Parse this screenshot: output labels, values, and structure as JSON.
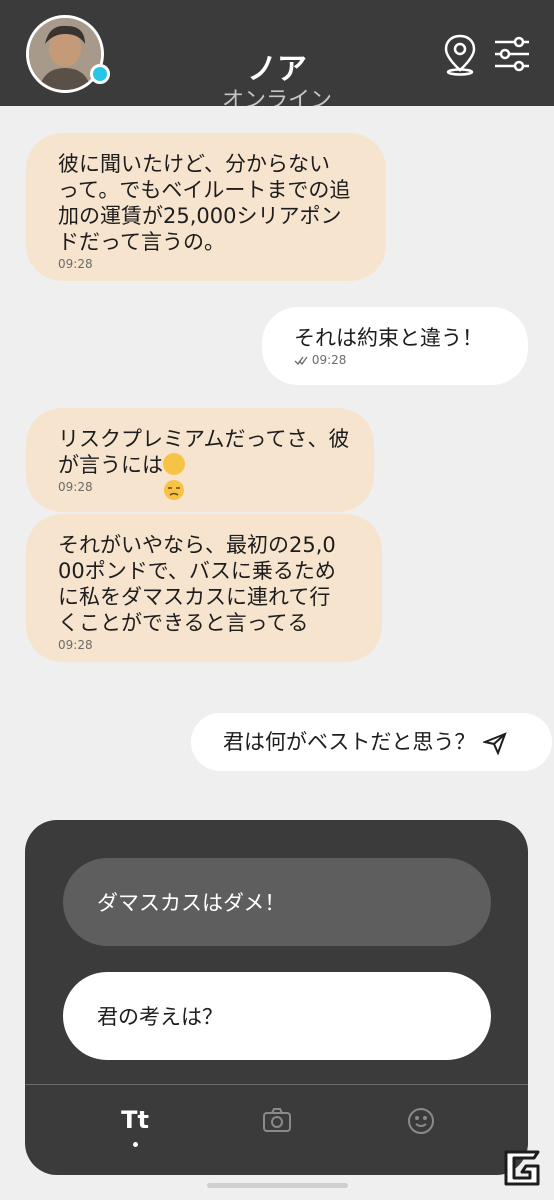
{
  "header": {
    "name": "ノア",
    "status": "オンライン",
    "avatar": "avatar",
    "icons": [
      "location-pin-icon",
      "filter-sliders-icon"
    ],
    "status_color": "#27c6e6"
  },
  "messages": [
    {
      "side": "incoming",
      "text": "彼に聞いたけど、分からない\nって。でもベイルートまでの追\n加の運賃が25,000シリアポン\nドだって言うの。",
      "time": "09:28"
    },
    {
      "side": "outgoing",
      "text": "それは約束と違う！",
      "time": "09:28",
      "read_icon": "double-check-icon"
    },
    {
      "side": "incoming",
      "text": "リスクプレミアムだってさ、彼\nが言うには",
      "time": "09:28",
      "emoji": "unamused-face-icon"
    },
    {
      "side": "incoming",
      "text": "それがいやなら、最初の25,0\n00ポンドで、バスに乗るため\nに私をダマスカスに連れて行\nくことができると言ってる",
      "time": "09:28"
    },
    {
      "side": "outgoing",
      "text": "君は何がベストだと思う？",
      "icon": "send-icon"
    }
  ],
  "replies": [
    {
      "label": "ダマスカスはダメ！",
      "selected": true
    },
    {
      "label": "君の考えは？",
      "selected": false
    }
  ],
  "input_tabs": [
    {
      "label": "Tt",
      "icon": "text-tab-icon",
      "active": true
    },
    {
      "icon": "camera-icon",
      "active": false
    },
    {
      "icon": "smiley-icon",
      "active": false
    }
  ],
  "colors": {
    "incoming_bubble": "#f7e4cf",
    "outgoing_bubble": "#ffffff",
    "header_bg": "#3b3b3b",
    "background": "#efefef"
  }
}
